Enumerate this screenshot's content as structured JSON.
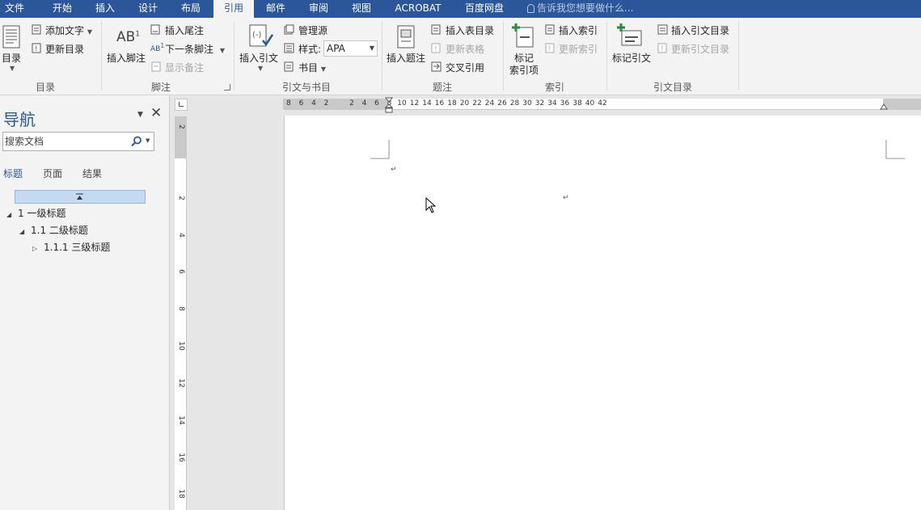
{
  "tabs": [
    {
      "label": "文件",
      "active": false
    },
    {
      "label": "开始",
      "active": false
    },
    {
      "label": "插入",
      "active": false
    },
    {
      "label": "设计",
      "active": false
    },
    {
      "label": "布局",
      "active": false
    },
    {
      "label": "引用",
      "active": true
    },
    {
      "label": "邮件",
      "active": false
    },
    {
      "label": "审阅",
      "active": false
    },
    {
      "label": "视图",
      "active": false
    },
    {
      "label": "ACROBAT",
      "active": false
    },
    {
      "label": "百度网盘",
      "active": false
    }
  ],
  "tell_me": "告诉我您想要做什么...",
  "ribbon": {
    "toc": {
      "big": "目录",
      "add_text": "添加文字",
      "update": "更新目录",
      "group": "目录"
    },
    "footnotes": {
      "big": "插入脚注",
      "insert_endnote": "插入尾注",
      "next_footnote": "下一条脚注",
      "show_notes": "显示备注",
      "group": "脚注",
      "icon_text": "AB"
    },
    "citations": {
      "big": "插入引文",
      "manage_sources": "管理源",
      "style_label": "样式:",
      "style_value": "APA",
      "bibliography": "书目",
      "group": "引文与书目"
    },
    "captions": {
      "big": "插入题注",
      "insert_tof": "插入表目录",
      "update_table": "更新表格",
      "cross_ref": "交叉引用",
      "group": "题注"
    },
    "index": {
      "big1": "标记",
      "big2": "索引项",
      "insert_index": "插入索引",
      "update_index": "更新索引",
      "group": "索引"
    },
    "toa": {
      "big": "标记引文",
      "insert_toa": "插入引文目录",
      "update_toa": "更新引文目录",
      "group": "引文目录"
    }
  },
  "nav": {
    "title": "导航",
    "search_placeholder": "搜索文档",
    "tabs": [
      "标题",
      "页面",
      "结果"
    ],
    "headings": [
      {
        "text": "1 一级标题",
        "level": 1,
        "expanded": true
      },
      {
        "text": "1.1 二级标题",
        "level": 2,
        "expanded": true
      },
      {
        "text": "1.1.1 三级标题",
        "level": 3,
        "expanded": false
      }
    ]
  },
  "ruler": {
    "h_labels": [
      "8",
      "6",
      "4",
      "2",
      "2",
      "4",
      "6",
      "8",
      "10",
      "12",
      "14",
      "16",
      "18",
      "20",
      "22",
      "24",
      "26",
      "28",
      "30",
      "32",
      "34",
      "36",
      "38",
      "40",
      "42"
    ],
    "v_labels": [
      "2",
      "2",
      "4",
      "6",
      "8",
      "10",
      "12",
      "14",
      "16",
      "18"
    ]
  },
  "colors": {
    "accent": "#2b579a",
    "ribbon_bg": "#f3f3f3",
    "nav_highlight": "#c5d9f1"
  }
}
